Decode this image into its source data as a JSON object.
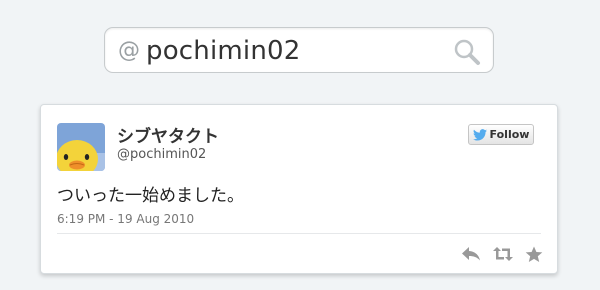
{
  "search": {
    "prefix": "@",
    "query": "pochimin02"
  },
  "tweet": {
    "display_name": "シブヤタクト",
    "handle": "@pochimin02",
    "follow_label": "Follow",
    "text": "ついった一始めました。",
    "timestamp": "6:19 PM - 19 Aug 2010",
    "actions": [
      "reply-icon",
      "retweet-icon",
      "favorite-icon"
    ]
  },
  "colors": {
    "background": "#f1f4f6",
    "twitter_bird": "#55acee",
    "action_icons": "#999999"
  }
}
